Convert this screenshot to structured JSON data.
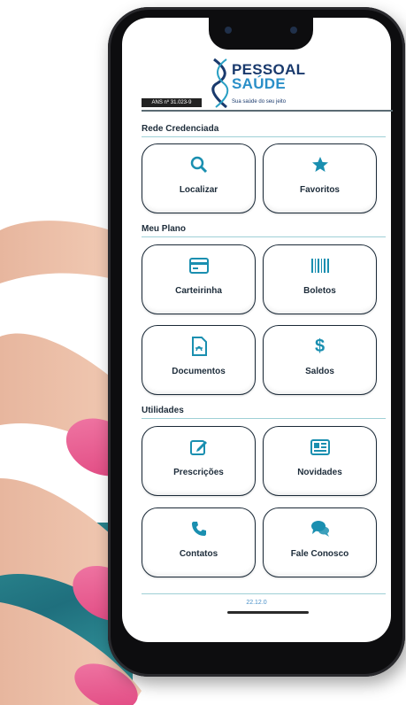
{
  "app": {
    "logo_name_line1": "PESSOAL",
    "logo_name_line2": "SAÚDE",
    "logo_tagline": "Sua saúde do seu jeito",
    "ans_badge": "ANS nº 31.023-9"
  },
  "sections": [
    {
      "title": "Rede Credenciada",
      "tiles": [
        {
          "label": "Localizar",
          "icon": "search-icon"
        },
        {
          "label": "Favoritos",
          "icon": "star-icon"
        }
      ]
    },
    {
      "title": "Meu Plano",
      "tiles": [
        {
          "label": "Carteirinha",
          "icon": "card-icon"
        },
        {
          "label": "Boletos",
          "icon": "barcode-icon"
        },
        {
          "label": "Documentos",
          "icon": "pdf-icon"
        },
        {
          "label": "Saldos",
          "icon": "dollar-icon"
        }
      ]
    },
    {
      "title": "Utilidades",
      "tiles": [
        {
          "label": "Prescrições",
          "icon": "edit-icon"
        },
        {
          "label": "Novidades",
          "icon": "news-icon"
        },
        {
          "label": "Contatos",
          "icon": "phone-icon"
        },
        {
          "label": "Fale Conosco",
          "icon": "chat-icon"
        }
      ]
    }
  ],
  "footer": {
    "version": "22.12.0"
  },
  "colors": {
    "accent": "#1a8fb0",
    "dark": "#1d2c3a",
    "logo": "#1a3a6d",
    "divider": "#9fd0d6"
  }
}
